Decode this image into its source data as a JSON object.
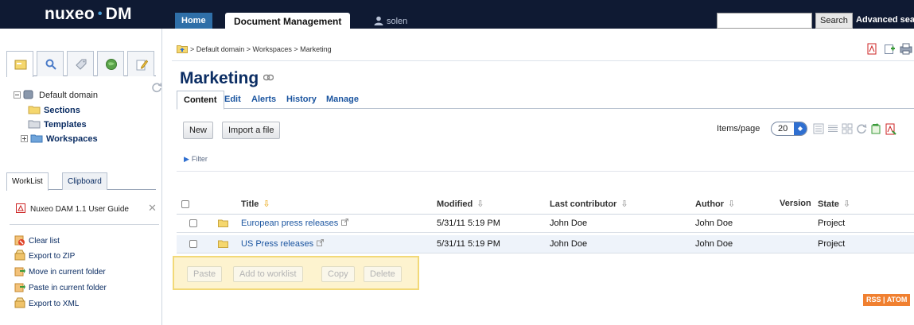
{
  "header": {
    "logo_left": "nuxeo",
    "logo_dot": "•",
    "logo_right": "DM",
    "tabs": [
      {
        "label": "Home"
      },
      {
        "label": "Document Management"
      }
    ],
    "user": "solen",
    "search_value": "",
    "search_button": "Search",
    "advanced_search": "Advanced search",
    "colors": {
      "bar": "#0f1a33",
      "home_tab": "#2f6fa8"
    }
  },
  "sidebar": {
    "tree": {
      "root": "Default domain",
      "children": [
        "Sections",
        "Templates",
        "Workspaces"
      ]
    },
    "worklist_tabs": [
      "WorkList",
      "Clipboard"
    ],
    "worklist_item": "Nuxeo DAM 1.1 User Guide",
    "actions": [
      "Clear list",
      "Export to ZIP",
      "Move in current folder",
      "Paste in current folder",
      "Export to XML"
    ]
  },
  "main": {
    "breadcrumb": "> Default domain > Workspaces > Marketing",
    "title": "Marketing",
    "tabs": [
      "Content",
      "Edit",
      "Alerts",
      "History",
      "Manage"
    ],
    "buttons": {
      "new": "New",
      "import": "Import a file"
    },
    "items_per_page_label": "Items/page",
    "items_per_page_value": "20",
    "filter": "Filter",
    "columns": [
      "Title",
      "Modified",
      "Last contributor",
      "Author",
      "Version",
      "State"
    ],
    "rows": [
      {
        "title": "European press releases",
        "modified": "5/31/11 5:19 PM",
        "contributor": "John Doe",
        "author": "John Doe",
        "version": "",
        "state": "Project"
      },
      {
        "title": "US Press releases",
        "modified": "5/31/11 5:19 PM",
        "contributor": "John Doe",
        "author": "John Doe",
        "version": "",
        "state": "Project"
      }
    ],
    "selection_actions": [
      "Paste",
      "Add to worklist",
      "Copy",
      "Delete"
    ],
    "feeds": "RSS | ATOM"
  }
}
